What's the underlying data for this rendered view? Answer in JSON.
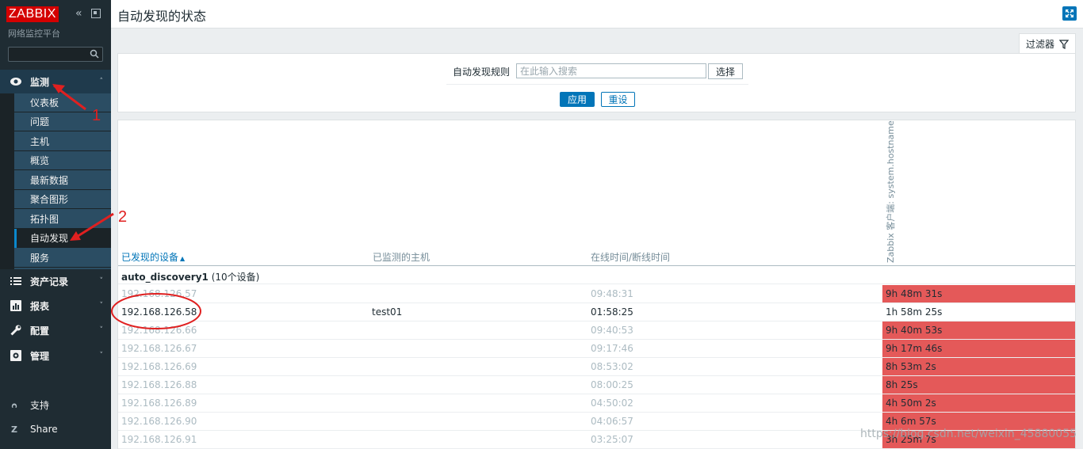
{
  "sidebar": {
    "logo": "ZABBIX",
    "subtitle": "网络监控平台",
    "monitoring": "监测",
    "submenu": [
      "仪表板",
      "问题",
      "主机",
      "概览",
      "最新数据",
      "聚合图形",
      "拓扑图",
      "自动发现",
      "服务"
    ],
    "active_item": "自动发现",
    "menu": [
      "资产记录",
      "报表",
      "配置",
      "管理"
    ],
    "support": "支持",
    "share": "Share"
  },
  "header": {
    "title": "自动发现的状态"
  },
  "filter": {
    "tab_label": "过滤器",
    "rule_label": "自动发现规则",
    "rule_placeholder": "在此输入搜索",
    "select_label": "选择",
    "apply_label": "应用",
    "reset_label": "重设"
  },
  "table": {
    "columns": {
      "device": "已发现的设备",
      "host": "已监测的主机",
      "uptime": "在线时间/断线时间",
      "check": "Zabbix 客户端: system.hostname"
    },
    "group": {
      "name": "auto_discovery1",
      "count": "(10个设备)"
    },
    "rows": [
      {
        "ip": "192.168.126.57",
        "host": "",
        "uptime": "09:48:31",
        "status": "9h 48m 31s",
        "online": false
      },
      {
        "ip": "192.168.126.58",
        "host": "test01",
        "uptime": "01:58:25",
        "status": "1h 58m 25s",
        "online": true
      },
      {
        "ip": "192.168.126.66",
        "host": "",
        "uptime": "09:40:53",
        "status": "9h 40m 53s",
        "online": false
      },
      {
        "ip": "192.168.126.67",
        "host": "",
        "uptime": "09:17:46",
        "status": "9h 17m 46s",
        "online": false
      },
      {
        "ip": "192.168.126.69",
        "host": "",
        "uptime": "08:53:02",
        "status": "8h 53m 2s",
        "online": false
      },
      {
        "ip": "192.168.126.88",
        "host": "",
        "uptime": "08:00:25",
        "status": "8h 25s",
        "online": false
      },
      {
        "ip": "192.168.126.89",
        "host": "",
        "uptime": "04:50:02",
        "status": "4h 50m 2s",
        "online": false
      },
      {
        "ip": "192.168.126.90",
        "host": "",
        "uptime": "04:06:57",
        "status": "4h 6m 57s",
        "online": false
      },
      {
        "ip": "192.168.126.91",
        "host": "",
        "uptime": "03:25:07",
        "status": "3h 25m 7s",
        "online": false
      }
    ]
  },
  "annotations": {
    "mark1": "1",
    "mark2": "2"
  },
  "watermark": "https://blog.csdn.net/weixin_45880055",
  "colors": {
    "sidebar": "#1f2c33",
    "accent": "#0275b8",
    "problem": "#e45959",
    "logo": "#d40000"
  }
}
